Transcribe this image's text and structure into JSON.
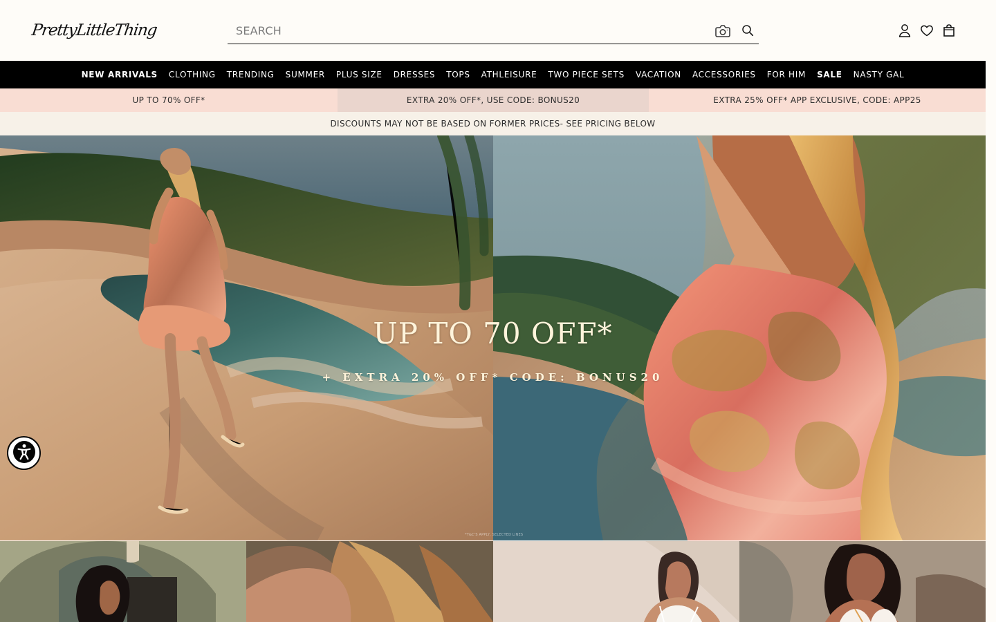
{
  "header": {
    "logo": "PrettyLittleThing",
    "search": {
      "placeholder": "SEARCH",
      "value": ""
    },
    "icons": {
      "camera": "camera-icon",
      "search": "search-icon",
      "account": "account-icon",
      "wishlist": "heart-icon",
      "bag": "bag-icon"
    }
  },
  "nav": {
    "items": [
      {
        "label": "NEW ARRIVALS",
        "bold": true
      },
      {
        "label": "CLOTHING",
        "bold": false
      },
      {
        "label": "TRENDING",
        "bold": false
      },
      {
        "label": "SUMMER",
        "bold": false
      },
      {
        "label": "PLUS SIZE",
        "bold": false
      },
      {
        "label": "DRESSES",
        "bold": false
      },
      {
        "label": "TOPS",
        "bold": false
      },
      {
        "label": "ATHLEISURE",
        "bold": false
      },
      {
        "label": "TWO PIECE SETS",
        "bold": false
      },
      {
        "label": "VACATION",
        "bold": false
      },
      {
        "label": "ACCESSORIES",
        "bold": false
      },
      {
        "label": "FOR HIM",
        "bold": false
      },
      {
        "label": "SALE",
        "bold": true
      },
      {
        "label": "NASTY GAL",
        "bold": false
      }
    ]
  },
  "promotions": [
    {
      "label": "UP TO 70% OFF*"
    },
    {
      "label": "EXTRA 20% OFF*, USE CODE: BONUS20"
    },
    {
      "label": "EXTRA 25% OFF* APP EXCLUSIVE, CODE: APP25"
    }
  ],
  "notice": {
    "label": "DISCOUNTS MAY NOT BE BASED ON FORMER PRICES- SEE PRICING BELOW"
  },
  "hero": {
    "title": "UP TO 70 OFF*",
    "subtitle": "+ EXTRA 20% OFF* CODE: BONUS20",
    "fine_print": "*T&C'S APPLY, SELECTED LINES"
  },
  "accessibility": {
    "icon": "accessibility-icon"
  },
  "colors": {
    "nav_background": "#000000",
    "promo_background": "#f9ddd3",
    "notice_background": "#f7f1e8",
    "page_background": "#fefcf8"
  }
}
